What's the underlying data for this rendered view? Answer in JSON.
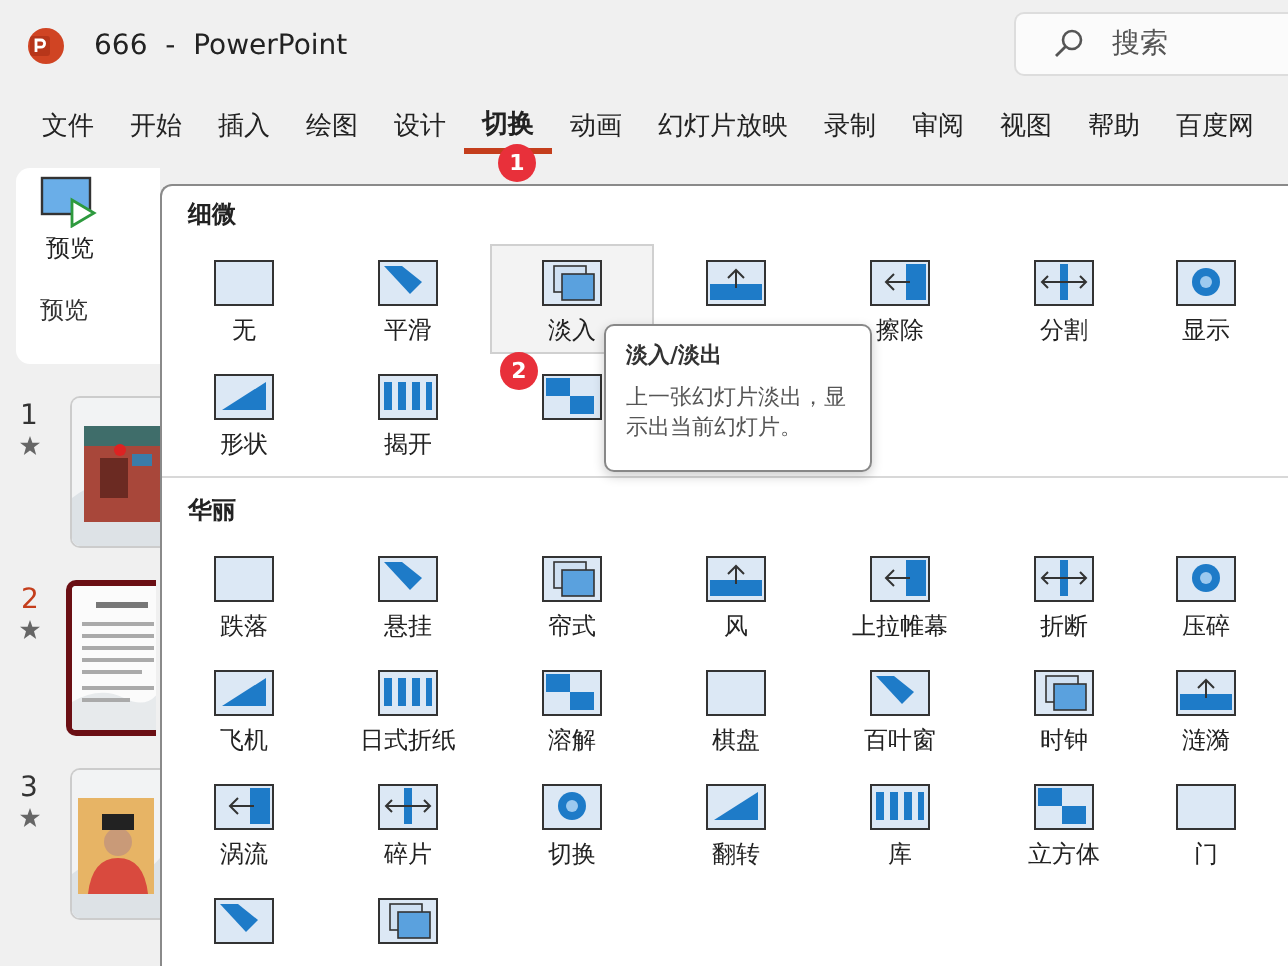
{
  "window": {
    "title": "666  -  PowerPoint"
  },
  "search": {
    "placeholder": "搜索"
  },
  "tabs": [
    {
      "label": "文件",
      "selected": false
    },
    {
      "label": "开始",
      "selected": false
    },
    {
      "label": "插入",
      "selected": false
    },
    {
      "label": "绘图",
      "selected": false
    },
    {
      "label": "设计",
      "selected": false
    },
    {
      "label": "切换",
      "selected": true
    },
    {
      "label": "动画",
      "selected": false
    },
    {
      "label": "幻灯片放映",
      "selected": false
    },
    {
      "label": "录制",
      "selected": false
    },
    {
      "label": "审阅",
      "selected": false
    },
    {
      "label": "视图",
      "selected": false
    },
    {
      "label": "帮助",
      "selected": false
    },
    {
      "label": "百度网",
      "selected": false
    }
  ],
  "ribbon": {
    "preview_button": "预览",
    "group_label": "预览"
  },
  "slides": [
    {
      "number": "1",
      "selected": false
    },
    {
      "number": "2",
      "selected": true
    },
    {
      "number": "3",
      "selected": false
    }
  ],
  "gallery": {
    "sections": [
      {
        "title": "细微",
        "items": [
          {
            "label": "无",
            "selected": false
          },
          {
            "label": "平滑",
            "selected": false
          },
          {
            "label": "淡入",
            "selected": true
          },
          {
            "selected": false
          },
          {
            "label": "擦除",
            "selected": false
          },
          {
            "label": "分割",
            "selected": false
          },
          {
            "label": "显示",
            "selected": false
          },
          {
            "label": "形状",
            "selected": false
          },
          {
            "label": "揭开",
            "selected": false
          },
          {
            "selected": false
          }
        ]
      },
      {
        "title": "华丽",
        "items": [
          {
            "label": "跌落",
            "selected": false
          },
          {
            "label": "悬挂",
            "selected": false
          },
          {
            "label": "帘式",
            "selected": false
          },
          {
            "label": "风",
            "selected": false
          },
          {
            "label": "上拉帷幕",
            "selected": false
          },
          {
            "label": "折断",
            "selected": false
          },
          {
            "label": "压碎",
            "selected": false
          },
          {
            "label": "飞机",
            "selected": false
          },
          {
            "label": "日式折纸",
            "selected": false
          },
          {
            "label": "溶解",
            "selected": false
          },
          {
            "label": "棋盘",
            "selected": false
          },
          {
            "label": "百叶窗",
            "selected": false
          },
          {
            "label": "时钟",
            "selected": false
          },
          {
            "label": "涟漪",
            "selected": false
          },
          {
            "label": "涡流",
            "selected": false
          },
          {
            "label": "碎片",
            "selected": false
          },
          {
            "label": "切换",
            "selected": false
          },
          {
            "label": "翻转",
            "selected": false
          },
          {
            "label": "库",
            "selected": false
          },
          {
            "label": "立方体",
            "selected": false
          },
          {
            "label": "门",
            "selected": false
          },
          {
            "selected": false
          },
          {
            "selected": false
          }
        ]
      }
    ]
  },
  "tooltip": {
    "title": "淡入/淡出",
    "text": "上一张幻灯片淡出，显示出当前幻灯片。"
  },
  "callouts": [
    "1",
    "2"
  ]
}
